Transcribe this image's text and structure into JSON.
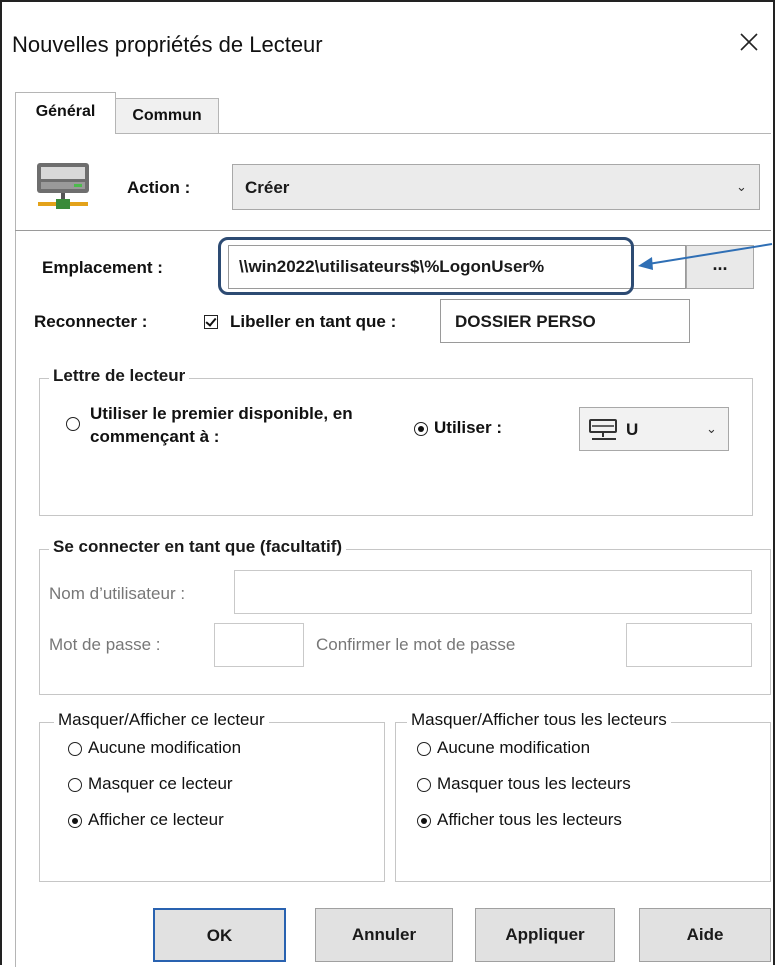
{
  "window": {
    "title": "Nouvelles propriétés de Lecteur"
  },
  "tabs": [
    {
      "label": "Général",
      "selected": true
    },
    {
      "label": "Commun",
      "selected": false
    }
  ],
  "action": {
    "label": "Action :",
    "value": "Créer"
  },
  "location": {
    "label": "Emplacement :",
    "value": "\\\\win2022\\utilisateurs$\\%LogonUser%",
    "browse_label": "..."
  },
  "reconnect": {
    "label": "Reconnecter :",
    "checked": true
  },
  "label_as": {
    "label": "Libeller en tant que :",
    "value": "DOSSIER PERSO"
  },
  "drive_letter": {
    "legend": "Lettre de lecteur",
    "first_available_line1": "Utiliser le premier disponible, en",
    "first_available_line2": "commençant à :",
    "use_label": "Utiliser :",
    "selected_option": "use",
    "letter": "U"
  },
  "connect_as": {
    "legend": "Se connecter en tant que (facultatif)",
    "username_label": "Nom d’utilisateur :",
    "password_label": "Mot de passe :",
    "confirm_label": "Confirmer le mot de passe"
  },
  "hide_show_this": {
    "legend": "Masquer/Afficher ce lecteur",
    "options": [
      "Aucune modification",
      "Masquer ce lecteur",
      "Afficher ce lecteur"
    ],
    "selected_index": 2
  },
  "hide_show_all": {
    "legend": "Masquer/Afficher tous les lecteurs",
    "options": [
      "Aucune modification",
      "Masquer tous les lecteurs",
      "Afficher tous les lecteurs"
    ],
    "selected_index": 2
  },
  "buttons": {
    "ok": "OK",
    "cancel": "Annuler",
    "apply": "Appliquer",
    "help": "Aide"
  },
  "colors": {
    "highlight": "#2d4b73",
    "arrow": "#2f6fb5",
    "default_button_border": "#2962b0"
  },
  "icons": [
    "close-icon",
    "network-drive-icon",
    "chevron-down-icon",
    "mini-drive-icon"
  ]
}
